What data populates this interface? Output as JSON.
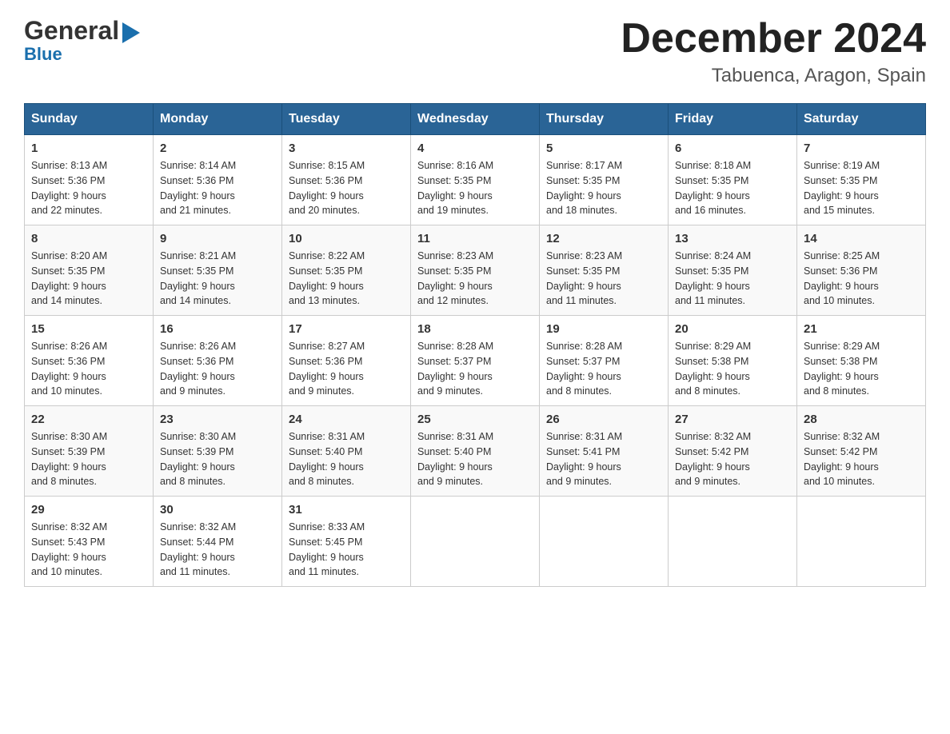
{
  "header": {
    "logo_general": "General",
    "logo_blue": "Blue",
    "month_title": "December 2024",
    "location": "Tabuenca, Aragon, Spain"
  },
  "days_of_week": [
    "Sunday",
    "Monday",
    "Tuesday",
    "Wednesday",
    "Thursday",
    "Friday",
    "Saturday"
  ],
  "weeks": [
    [
      {
        "day": "1",
        "sunrise": "8:13 AM",
        "sunset": "5:36 PM",
        "daylight": "9 hours and 22 minutes."
      },
      {
        "day": "2",
        "sunrise": "8:14 AM",
        "sunset": "5:36 PM",
        "daylight": "9 hours and 21 minutes."
      },
      {
        "day": "3",
        "sunrise": "8:15 AM",
        "sunset": "5:36 PM",
        "daylight": "9 hours and 20 minutes."
      },
      {
        "day": "4",
        "sunrise": "8:16 AM",
        "sunset": "5:35 PM",
        "daylight": "9 hours and 19 minutes."
      },
      {
        "day": "5",
        "sunrise": "8:17 AM",
        "sunset": "5:35 PM",
        "daylight": "9 hours and 18 minutes."
      },
      {
        "day": "6",
        "sunrise": "8:18 AM",
        "sunset": "5:35 PM",
        "daylight": "9 hours and 16 minutes."
      },
      {
        "day": "7",
        "sunrise": "8:19 AM",
        "sunset": "5:35 PM",
        "daylight": "9 hours and 15 minutes."
      }
    ],
    [
      {
        "day": "8",
        "sunrise": "8:20 AM",
        "sunset": "5:35 PM",
        "daylight": "9 hours and 14 minutes."
      },
      {
        "day": "9",
        "sunrise": "8:21 AM",
        "sunset": "5:35 PM",
        "daylight": "9 hours and 14 minutes."
      },
      {
        "day": "10",
        "sunrise": "8:22 AM",
        "sunset": "5:35 PM",
        "daylight": "9 hours and 13 minutes."
      },
      {
        "day": "11",
        "sunrise": "8:23 AM",
        "sunset": "5:35 PM",
        "daylight": "9 hours and 12 minutes."
      },
      {
        "day": "12",
        "sunrise": "8:23 AM",
        "sunset": "5:35 PM",
        "daylight": "9 hours and 11 minutes."
      },
      {
        "day": "13",
        "sunrise": "8:24 AM",
        "sunset": "5:35 PM",
        "daylight": "9 hours and 11 minutes."
      },
      {
        "day": "14",
        "sunrise": "8:25 AM",
        "sunset": "5:36 PM",
        "daylight": "9 hours and 10 minutes."
      }
    ],
    [
      {
        "day": "15",
        "sunrise": "8:26 AM",
        "sunset": "5:36 PM",
        "daylight": "9 hours and 10 minutes."
      },
      {
        "day": "16",
        "sunrise": "8:26 AM",
        "sunset": "5:36 PM",
        "daylight": "9 hours and 9 minutes."
      },
      {
        "day": "17",
        "sunrise": "8:27 AM",
        "sunset": "5:36 PM",
        "daylight": "9 hours and 9 minutes."
      },
      {
        "day": "18",
        "sunrise": "8:28 AM",
        "sunset": "5:37 PM",
        "daylight": "9 hours and 9 minutes."
      },
      {
        "day": "19",
        "sunrise": "8:28 AM",
        "sunset": "5:37 PM",
        "daylight": "9 hours and 8 minutes."
      },
      {
        "day": "20",
        "sunrise": "8:29 AM",
        "sunset": "5:38 PM",
        "daylight": "9 hours and 8 minutes."
      },
      {
        "day": "21",
        "sunrise": "8:29 AM",
        "sunset": "5:38 PM",
        "daylight": "9 hours and 8 minutes."
      }
    ],
    [
      {
        "day": "22",
        "sunrise": "8:30 AM",
        "sunset": "5:39 PM",
        "daylight": "9 hours and 8 minutes."
      },
      {
        "day": "23",
        "sunrise": "8:30 AM",
        "sunset": "5:39 PM",
        "daylight": "9 hours and 8 minutes."
      },
      {
        "day": "24",
        "sunrise": "8:31 AM",
        "sunset": "5:40 PM",
        "daylight": "9 hours and 8 minutes."
      },
      {
        "day": "25",
        "sunrise": "8:31 AM",
        "sunset": "5:40 PM",
        "daylight": "9 hours and 9 minutes."
      },
      {
        "day": "26",
        "sunrise": "8:31 AM",
        "sunset": "5:41 PM",
        "daylight": "9 hours and 9 minutes."
      },
      {
        "day": "27",
        "sunrise": "8:32 AM",
        "sunset": "5:42 PM",
        "daylight": "9 hours and 9 minutes."
      },
      {
        "day": "28",
        "sunrise": "8:32 AM",
        "sunset": "5:42 PM",
        "daylight": "9 hours and 10 minutes."
      }
    ],
    [
      {
        "day": "29",
        "sunrise": "8:32 AM",
        "sunset": "5:43 PM",
        "daylight": "9 hours and 10 minutes."
      },
      {
        "day": "30",
        "sunrise": "8:32 AM",
        "sunset": "5:44 PM",
        "daylight": "9 hours and 11 minutes."
      },
      {
        "day": "31",
        "sunrise": "8:33 AM",
        "sunset": "5:45 PM",
        "daylight": "9 hours and 11 minutes."
      },
      null,
      null,
      null,
      null
    ]
  ],
  "labels": {
    "sunrise": "Sunrise:",
    "sunset": "Sunset:",
    "daylight": "Daylight:"
  }
}
